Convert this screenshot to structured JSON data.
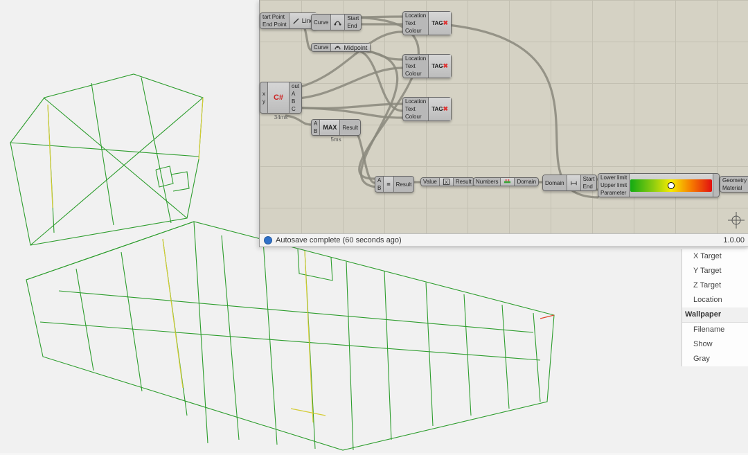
{
  "gh": {
    "status_text": "Autosave complete (60 seconds ago)",
    "version": "1.0.00",
    "components": {
      "line": {
        "inputs": [
          "tart Point",
          "End Point"
        ],
        "label": "Line",
        "outputs": [],
        "icon": "line"
      },
      "endpts": {
        "inputs": [
          "Curve"
        ],
        "label": "",
        "outputs": [
          "Start",
          "End"
        ],
        "icon": "endpoints"
      },
      "midpt": {
        "inputs": [
          "Curve"
        ],
        "label": "Midpoint",
        "outputs": [],
        "icon": "midpoint"
      },
      "csharp": {
        "inputs": [
          "x",
          "y"
        ],
        "label": "C#",
        "outputs": [
          "out",
          "A",
          "B",
          "C"
        ],
        "caption": "34ms"
      },
      "max": {
        "inputs": [
          "A",
          "B"
        ],
        "label": "MAX",
        "outputs": [
          "Result"
        ],
        "caption": "5ms"
      },
      "tag": {
        "inputs": [
          "Location",
          "Text",
          "Colour"
        ],
        "label": "TAG",
        "outputs": []
      },
      "eqB": {
        "inputs": [
          "A",
          "B"
        ],
        "label": "=",
        "outputs": [
          "Result"
        ]
      },
      "valuelist": {
        "inputs": [
          "Value"
        ],
        "label": "",
        "outputs": [
          "Result"
        ],
        "icon": "valuelist"
      },
      "bounds": {
        "inputs": [
          "Numbers"
        ],
        "label": "",
        "outputs": [
          "Domain"
        ],
        "icon": "bounds"
      },
      "decon": {
        "inputs": [
          "Domain"
        ],
        "label": "",
        "outputs": [
          "Start",
          "End"
        ],
        "icon": "decon"
      },
      "gradient": {
        "inputs": [
          "Lower limit",
          "Upper limit",
          "Parameter"
        ],
        "outputs": [
          ""
        ],
        "grips": [
          0.5
        ]
      },
      "preview": {
        "inputs": [
          "Geometry",
          "Material"
        ],
        "label": "",
        "outputs": [],
        "icon": "preview"
      }
    }
  },
  "side_panel": {
    "camera_items": [
      "X Target",
      "Y Target",
      "Z Target",
      "Location"
    ],
    "group": "Wallpaper",
    "group_items": [
      "Filename",
      "Show",
      "Gray"
    ]
  }
}
